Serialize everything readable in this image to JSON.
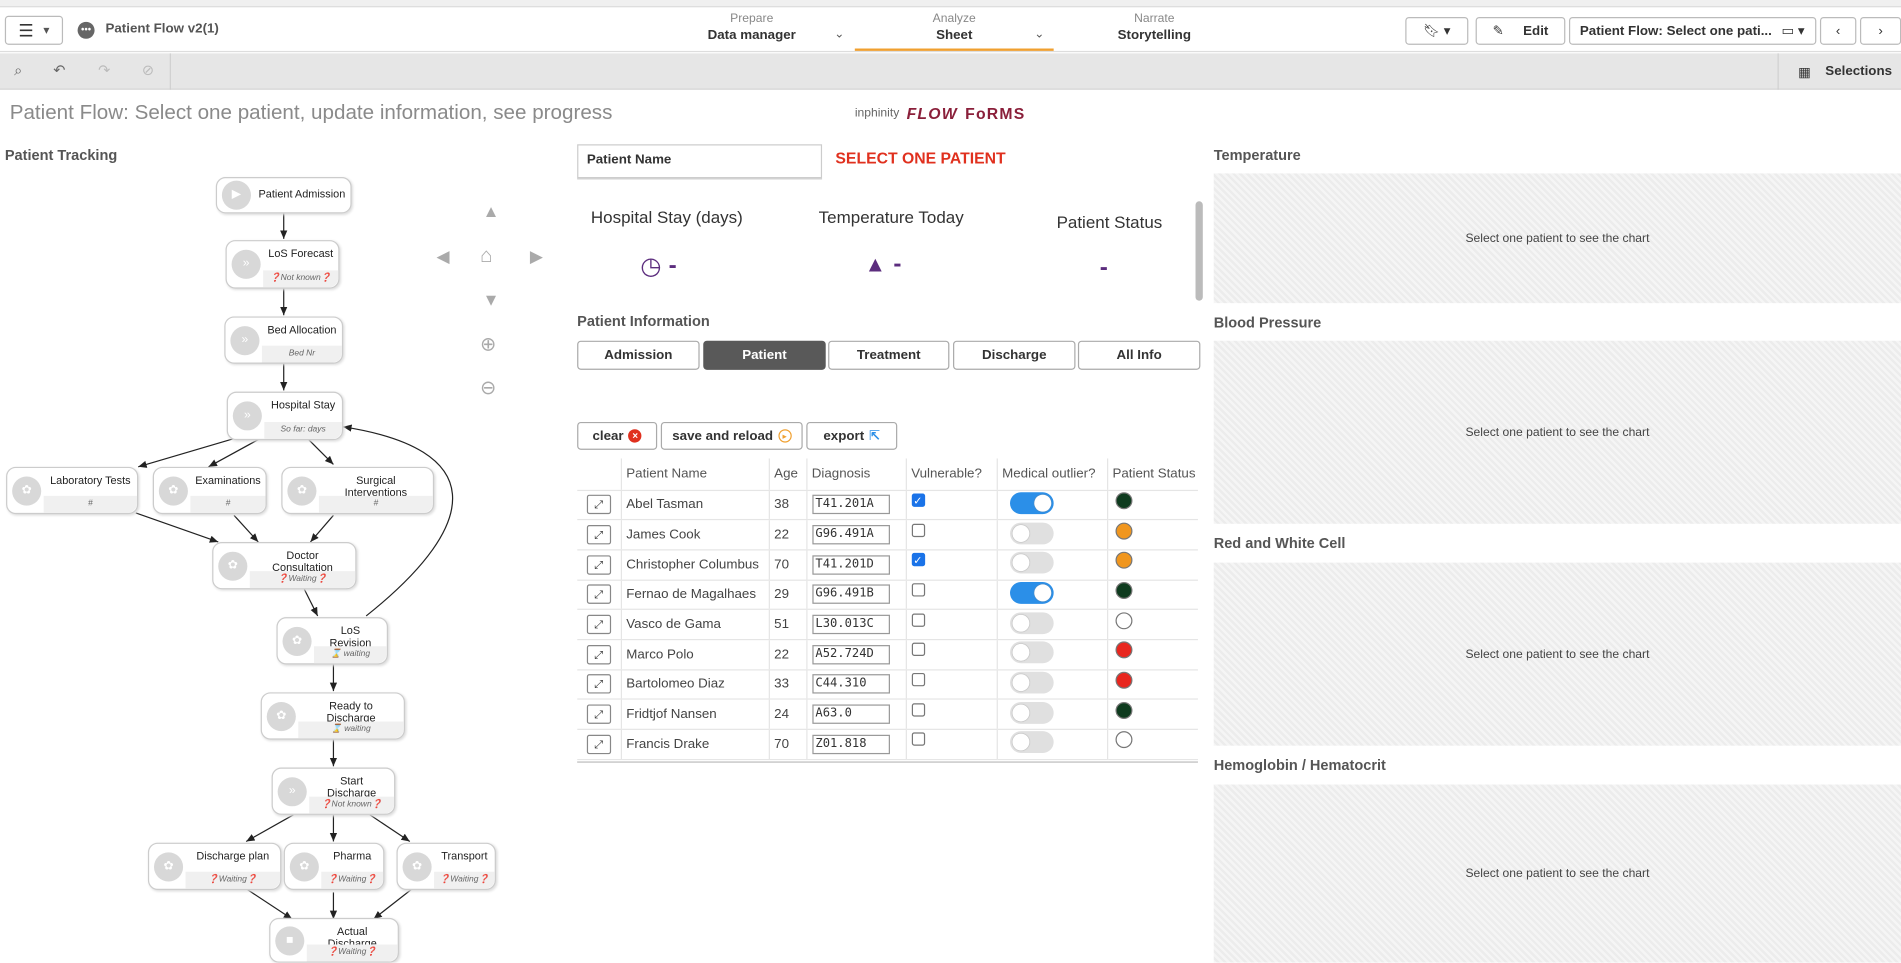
{
  "app": {
    "title": "Patient Flow v2(1)"
  },
  "nav": [
    {
      "top": "Prepare",
      "main": "Data manager"
    },
    {
      "top": "Analyze",
      "main": "Sheet"
    },
    {
      "top": "Narrate",
      "main": "Storytelling"
    }
  ],
  "header": {
    "edit_label": "Edit",
    "sheet_selector": "Patient Flow: Select one pati..."
  },
  "toolbar": {
    "selections_label": "Selections"
  },
  "page": {
    "title": "Patient Flow: Select one patient, update information, see progress"
  },
  "logo": {
    "brand": "inphinity",
    "flow": "FLOW",
    "forms": "FoRMS"
  },
  "flow": {
    "title": "Patient Tracking",
    "nodes": [
      {
        "label": "Patient Admission",
        "sub": ""
      },
      {
        "label": "LoS Forecast",
        "sub": "❓Not known❓"
      },
      {
        "label": "Bed Allocation",
        "sub": "Bed Nr"
      },
      {
        "label": "Hospital Stay",
        "sub": "So far:  days"
      },
      {
        "label": "Laboratory Tests",
        "sub": "#"
      },
      {
        "label": "Examinations",
        "sub": "#"
      },
      {
        "label": "Surgical Interventions",
        "sub": "#"
      },
      {
        "label": "Doctor Consultation",
        "sub": "❓Waiting❓"
      },
      {
        "label": "LoS Revision",
        "sub": "⌛ waiting"
      },
      {
        "label": "Ready to Discharge",
        "sub": "⌛ waiting"
      },
      {
        "label": "Start Discharge",
        "sub": "❓Not known❓"
      },
      {
        "label": "Discharge plan",
        "sub": "❓Waiting❓"
      },
      {
        "label": "Pharma",
        "sub": "❓Waiting❓"
      },
      {
        "label": "Transport",
        "sub": "❓Waiting❓"
      },
      {
        "label": "Actual Discharge",
        "sub": "❓Waiting❓"
      }
    ]
  },
  "patient": {
    "name_label": "Patient Name",
    "select_msg": "SELECT ONE PATIENT",
    "kpi": [
      {
        "title": "Hospital Stay (days)",
        "value": "-"
      },
      {
        "title": "Temperature Today",
        "value": "-"
      },
      {
        "title": "Patient Status",
        "value": "-"
      }
    ],
    "info_title": "Patient Information",
    "tabs": [
      "Admission",
      "Patient",
      "Treatment",
      "Discharge",
      "All Info"
    ],
    "active_tab": "Patient",
    "actions": {
      "clear": "clear",
      "save": "save and reload",
      "export": "export"
    }
  },
  "table": {
    "columns": [
      "Patient Name",
      "Age",
      "Diagnosis",
      "Vulnerable?",
      "Medical outlier?",
      "Patient Status"
    ],
    "rows": [
      {
        "name": "Abel Tasman",
        "age": "38",
        "diagnosis": "T41.201A",
        "vulnerable": true,
        "outlier": true,
        "status": "#0e3b1e"
      },
      {
        "name": "James Cook",
        "age": "22",
        "diagnosis": "G96.491A",
        "vulnerable": false,
        "outlier": false,
        "status": "#f0961e"
      },
      {
        "name": "Christopher Columbus",
        "age": "70",
        "diagnosis": "T41.201D",
        "vulnerable": true,
        "outlier": false,
        "status": "#f0961e"
      },
      {
        "name": "Fernao de Magalhaes",
        "age": "29",
        "diagnosis": "G96.491B",
        "vulnerable": false,
        "outlier": true,
        "status": "#0e3b1e"
      },
      {
        "name": "Vasco de Gama",
        "age": "51",
        "diagnosis": "L30.013C",
        "vulnerable": false,
        "outlier": false,
        "status": "#ffffff"
      },
      {
        "name": "Marco Polo",
        "age": "22",
        "diagnosis": "A52.724D",
        "vulnerable": false,
        "outlier": false,
        "status": "#e8261e"
      },
      {
        "name": "Bartolomeo Diaz",
        "age": "33",
        "diagnosis": "C44.310",
        "vulnerable": false,
        "outlier": false,
        "status": "#e8261e"
      },
      {
        "name": "Fridtjof Nansen",
        "age": "24",
        "diagnosis": "A63.0",
        "vulnerable": false,
        "outlier": false,
        "status": "#0e3b1e"
      },
      {
        "name": "Francis Drake",
        "age": "70",
        "diagnosis": "Z01.818",
        "vulnerable": false,
        "outlier": false,
        "status": "#ffffff"
      }
    ]
  },
  "charts": [
    {
      "title": "Temperature",
      "msg": "Select one patient to see the chart"
    },
    {
      "title": "Blood Pressure",
      "msg": "Select one patient to see the chart"
    },
    {
      "title": "Red and White Cell",
      "msg": "Select one patient to see the chart"
    },
    {
      "title": "Hemoglobin / Hematocrit",
      "msg": "Select one patient to see the chart"
    }
  ]
}
